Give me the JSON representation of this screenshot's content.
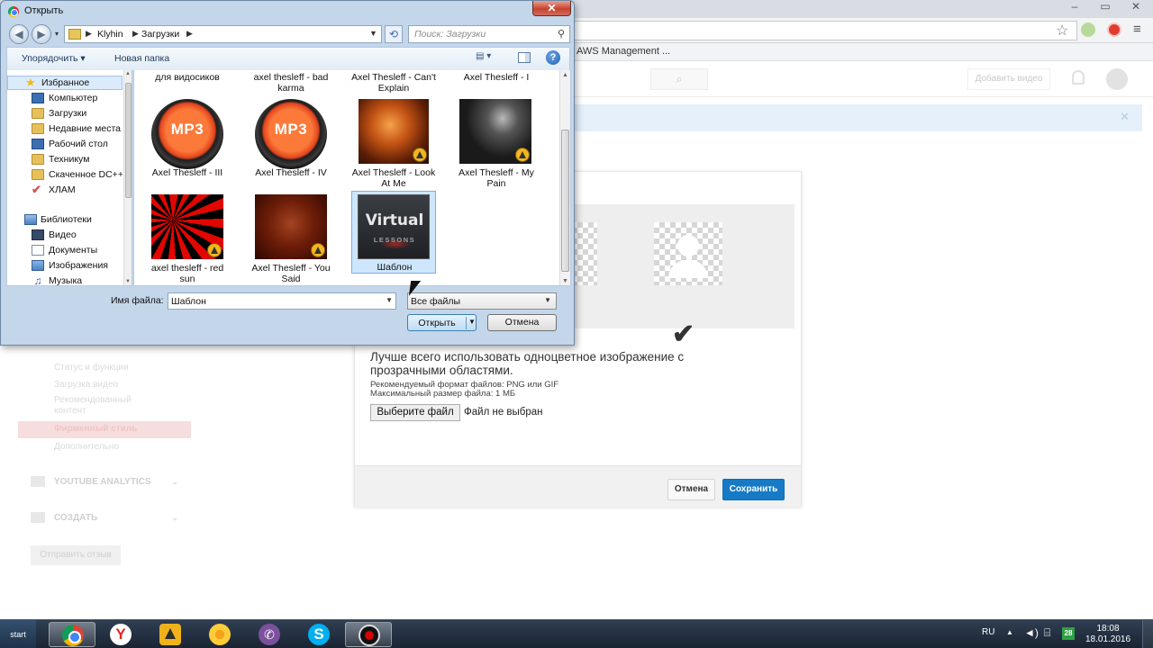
{
  "browser": {
    "bookmark": "AWS Management ...",
    "menu_icon": "menu-icon",
    "star_icon": "star-icon"
  },
  "youtube": {
    "upload_button": "Добавить видео",
    "sidebar": {
      "items": [
        "Статус и функции",
        "Загрузка видео",
        "Рекомендованный контент",
        "Фирменный стиль",
        "Дополнительно"
      ],
      "active": "Фирменный стиль",
      "section_analytics": "YOUTUBE ANALYTICS",
      "section_create": "СОЗДАТЬ",
      "feedback_button": "Отправить отзыв"
    },
    "modal": {
      "main_text": "Лучше всего использовать одноцветное изображение с прозрачными областями.",
      "formats_line": "Рекомендуемый формат файлов: PNG или GIF",
      "size_line": "Максимальный размер файла: 1 МБ",
      "choose_file_button": "Выберите файл",
      "no_file_text": "Файл не выбран",
      "cancel_button": "Отмена",
      "save_button": "Сохранить",
      "accent_color": "#167ac6"
    }
  },
  "dialog": {
    "title": "Открыть",
    "close_glyph": "✕",
    "breadcrumb": [
      "Klyhin",
      "Загрузки"
    ],
    "search_placeholder": "Поиск: Загрузки",
    "toolbar": {
      "organize": "Упорядочить ▾",
      "new_folder": "Новая папка",
      "help_glyph": "?"
    },
    "nav": {
      "favorites_header": "Избранное",
      "favorites": [
        "Компьютер",
        "Загрузки",
        "Недавние места",
        "Рабочий стол",
        "Техникум",
        "Скаченное DC++",
        "ХЛАМ"
      ],
      "libraries_header": "Библиотеки",
      "libraries": [
        "Видео",
        "Документы",
        "Изображения",
        "Музыка"
      ]
    },
    "files_partial": [
      "для видосиков",
      "axel thesleff - bad karma",
      "Axel Thesleff - Can't Explain",
      "Axel Thesleff - I"
    ],
    "files": [
      {
        "name": "Axel Thesleff - III",
        "thumb": "mp3"
      },
      {
        "name": "Axel Thesleff - IV",
        "thumb": "mp3"
      },
      {
        "name": "Axel Thesleff - Look At Me",
        "thumb": "album-art-orange"
      },
      {
        "name": "Axel Thesleff - My Pain",
        "thumb": "album-art-dark"
      },
      {
        "name": "axel thesleff - red sun",
        "thumb": "album-art-red-rays"
      },
      {
        "name": "Axel Thesleff - You Said",
        "thumb": "album-art-brown"
      },
      {
        "name": "Шаблон",
        "thumb": "image-virtual-lessons",
        "selected": true
      }
    ],
    "mp3_label": "MP3",
    "virtual_text": "Virtual",
    "lessons_text": "LESSONS",
    "filename_label": "Имя файла:",
    "filename_value": "Шаблон",
    "filetype_value": "Все файлы",
    "open_button": "Открыть",
    "cancel_button": "Отмена"
  },
  "taskbar": {
    "start": "start",
    "apps": [
      "chrome",
      "yandex-browser",
      "aimp",
      "icq",
      "viber",
      "skype",
      "screen-recorder"
    ],
    "yandex_glyph": "Y",
    "skype_glyph": "S",
    "viber_glyph": "✆",
    "lang": "RU",
    "tray_badge": "28",
    "time": "18:08",
    "date": "18.01.2016"
  }
}
